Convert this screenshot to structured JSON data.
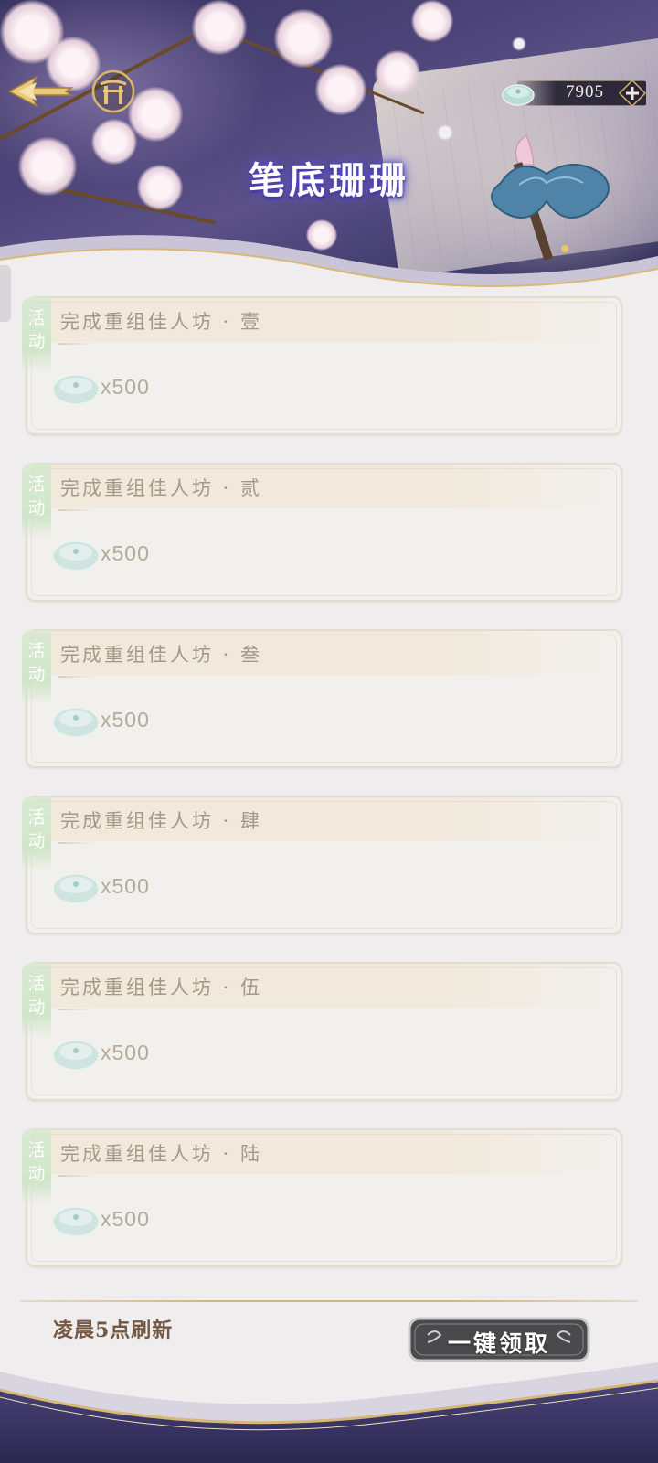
{
  "header": {
    "title": "笔底珊珊",
    "currency": {
      "amount": "7905",
      "icon": "jade-coin-icon"
    }
  },
  "tasks": [
    {
      "tag": "活动",
      "title": "完成重组佳人坊 · 壹",
      "reward_amount": "x500",
      "reward_icon": "jade-coin-icon"
    },
    {
      "tag": "活动",
      "title": "完成重组佳人坊 · 贰",
      "reward_amount": "x500",
      "reward_icon": "jade-coin-icon"
    },
    {
      "tag": "活动",
      "title": "完成重组佳人坊 · 叁",
      "reward_amount": "x500",
      "reward_icon": "jade-coin-icon"
    },
    {
      "tag": "活动",
      "title": "完成重组佳人坊 · 肆",
      "reward_amount": "x500",
      "reward_icon": "jade-coin-icon"
    },
    {
      "tag": "活动",
      "title": "完成重组佳人坊 · 伍",
      "reward_amount": "x500",
      "reward_icon": "jade-coin-icon"
    },
    {
      "tag": "活动",
      "title": "完成重组佳人坊 · 陆",
      "reward_amount": "x500",
      "reward_icon": "jade-coin-icon"
    }
  ],
  "footer": {
    "refresh_note": "凌晨5点刷新",
    "claim_all_label": "一键领取"
  },
  "colors": {
    "header_purple": "#4c4478",
    "tag_green": "#cfe6c8",
    "card_bg": "#f2f0ed",
    "gold_accent": "#d5b57c"
  }
}
